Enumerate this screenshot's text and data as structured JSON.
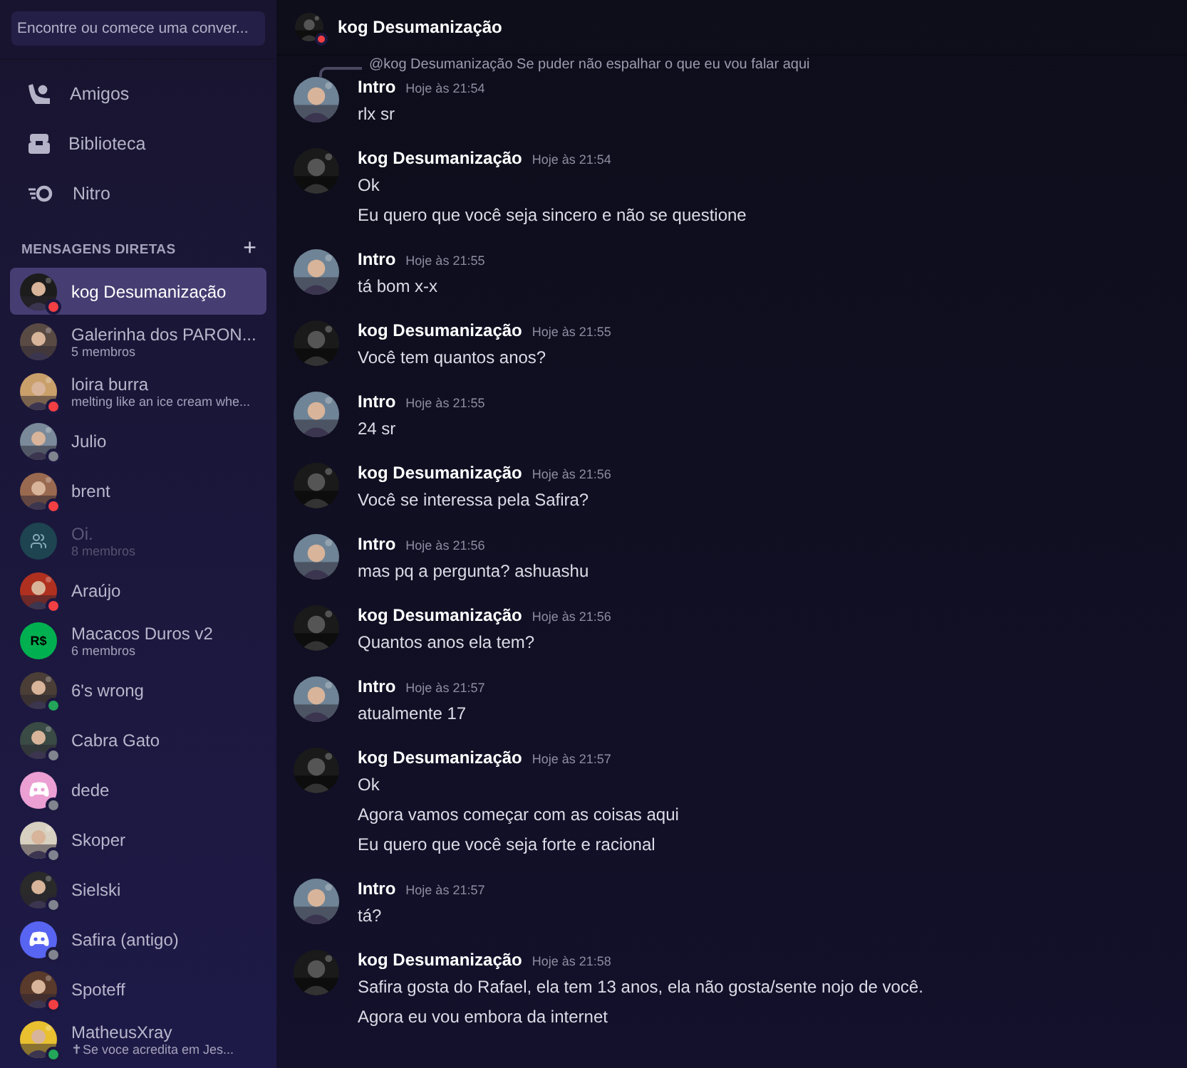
{
  "sidebar": {
    "search": {
      "placeholder": "Encontre ou comece uma conver..."
    },
    "nav": [
      {
        "label": "Amigos"
      },
      {
        "label": "Biblioteca"
      },
      {
        "label": "Nitro"
      }
    ],
    "section_title": "MENSAGENS DIRETAS",
    "add_label": "+",
    "dms": [
      {
        "name": "kog Desumanização",
        "selected": true,
        "color": "#f23f43"
      },
      {
        "name": "Galerinha dos PARON...",
        "subtitle": "5 membros",
        "selected": false
      },
      {
        "name": "loira burra",
        "subtitle": "melting like an ice cream whe...",
        "selected": false,
        "color": "#f23f43"
      },
      {
        "name": "Julio",
        "selected": false,
        "color": "#80848e"
      },
      {
        "name": "brent",
        "selected": false,
        "color": "#f23f43"
      },
      {
        "name": "Oi.",
        "subtitle": "8 membros",
        "selected": false,
        "muted": true,
        "avatar": {
          "kind": "group",
          "color": "#1d4450"
        }
      },
      {
        "name": "Araújo",
        "selected": false,
        "color": "#f23f43"
      },
      {
        "name": "Macacos Duros v2",
        "subtitle": "6 membros",
        "selected": false,
        "avatar": {
          "kind": "logo",
          "color": "#00b050",
          "text": "R$"
        }
      },
      {
        "name": "6's wrong",
        "selected": false,
        "color": "#23a55a"
      },
      {
        "name": "Cabra Gato",
        "selected": false,
        "color": "#80848e"
      },
      {
        "name": "dede",
        "selected": false,
        "color": "#80848e",
        "avatar": {
          "kind": "mascot",
          "color": "#eb9fd3"
        }
      },
      {
        "name": "Skoper",
        "selected": false,
        "color": "#80848e"
      },
      {
        "name": "Sielski",
        "selected": false,
        "color": "#80848e"
      },
      {
        "name": "Safira (antigo)",
        "selected": false,
        "color": "#80848e",
        "avatar": {
          "kind": "mascot",
          "color": "#5865f2"
        }
      },
      {
        "name": "Spoteff",
        "selected": false,
        "color": "#f23f43"
      },
      {
        "name": "MatheusXray",
        "subtitle": "✝Se voce acredita em Jes...",
        "selected": false,
        "color": "#23a55a"
      }
    ]
  },
  "header": {
    "title": "kog Desumanização",
    "color": "#f23f43"
  },
  "reply_preview": {
    "text": "@kog Desumanização Se puder não espalhar o que eu vou falar aqui"
  },
  "messages": [
    {
      "author": "Intro",
      "time": "Hoje às 21:54",
      "lines": [
        "rlx sr"
      ]
    },
    {
      "author": "kog Desumanização",
      "time": "Hoje às 21:54",
      "lines": [
        "Ok",
        "Eu quero que você seja sincero e não se questione"
      ]
    },
    {
      "author": "Intro",
      "time": "Hoje às 21:55",
      "lines": [
        "tá bom x-x"
      ]
    },
    {
      "author": "kog Desumanização",
      "time": "Hoje às 21:55",
      "lines": [
        "Você tem quantos anos?"
      ]
    },
    {
      "author": "Intro",
      "time": "Hoje às 21:55",
      "lines": [
        "24 sr"
      ]
    },
    {
      "author": "kog Desumanização",
      "time": "Hoje às 21:56",
      "lines": [
        "Você se interessa pela Safira?"
      ]
    },
    {
      "author": "Intro",
      "time": "Hoje às 21:56",
      "lines": [
        "mas pq a pergunta? ashuashu"
      ]
    },
    {
      "author": "kog Desumanização",
      "time": "Hoje às 21:56",
      "lines": [
        "Quantos anos ela tem?"
      ]
    },
    {
      "author": "Intro",
      "time": "Hoje às 21:57",
      "lines": [
        "atualmente 17"
      ]
    },
    {
      "author": "kog Desumanização",
      "time": "Hoje às 21:57",
      "lines": [
        "Ok",
        "Agora vamos começar com as coisas aqui",
        "Eu quero que você seja forte e racional"
      ]
    },
    {
      "author": "Intro",
      "time": "Hoje às 21:57",
      "lines": [
        "tá?"
      ]
    },
    {
      "author": "kog Desumanização",
      "time": "Hoje às 21:58",
      "lines": [
        "Safira gosta do Rafael, ela tem 13 anos, ela não gosta/sente nojo de você.",
        "Agora eu vou embora da internet"
      ]
    }
  ]
}
